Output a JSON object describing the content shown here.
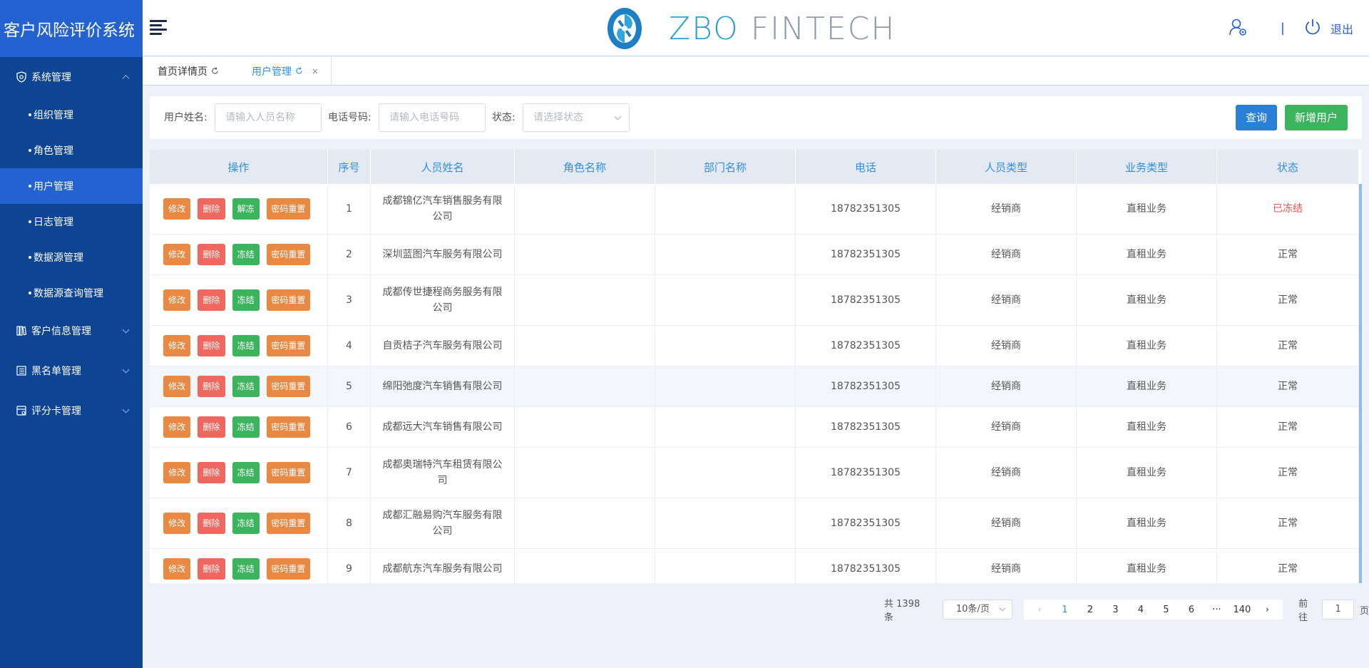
{
  "app": {
    "title": "客户风险评价系统"
  },
  "header": {
    "logo_text_primary": "ZBO",
    "logo_text_secondary": "FINTECH",
    "logout_label": "退出",
    "separator": "|"
  },
  "sidebar": {
    "groups": [
      {
        "label": "系统管理",
        "icon": "shield-gear-icon",
        "expanded": true,
        "items": [
          {
            "label": "组织管理",
            "active": false
          },
          {
            "label": "角色管理",
            "active": false
          },
          {
            "label": "用户管理",
            "active": true
          },
          {
            "label": "日志管理",
            "active": false
          },
          {
            "label": "数据源管理",
            "active": false
          },
          {
            "label": "数据源查询管理",
            "active": false
          }
        ]
      },
      {
        "label": "客户信息管理",
        "icon": "books-icon",
        "expanded": false
      },
      {
        "label": "黑名单管理",
        "icon": "list-book-icon",
        "expanded": false
      },
      {
        "label": "评分卡管理",
        "icon": "card-icon",
        "expanded": false
      }
    ]
  },
  "tabs": [
    {
      "label": "首页详情页",
      "active": false
    },
    {
      "label": "用户管理",
      "active": true,
      "close": "×"
    }
  ],
  "filter": {
    "name_label": "用户姓名:",
    "name_placeholder": "请输入人员名称",
    "phone_label": "电话号码:",
    "phone_placeholder": "请输入电话号码",
    "status_label": "状态:",
    "status_placeholder": "请选择状态",
    "query_button": "查询",
    "add_button": "新增用户"
  },
  "table": {
    "columns": [
      "操作",
      "序号",
      "人员姓名",
      "角色名称",
      "部门名称",
      "电话",
      "人员类型",
      "业务类型",
      "状态"
    ],
    "actions": {
      "edit": "修改",
      "delete": "删除",
      "reset": "密码重置"
    },
    "rows": [
      {
        "no": "1",
        "name": "成都锦亿汽车销售服务有限公司",
        "role": "",
        "dept": "",
        "phone": "18782351305",
        "ptype": "经销商",
        "btype": "直租业务",
        "status": "已冻结",
        "toggle": "解冻",
        "frozen": true
      },
      {
        "no": "2",
        "name": "深圳蓝图汽车服务有限公司",
        "role": "",
        "dept": "",
        "phone": "18782351305",
        "ptype": "经销商",
        "btype": "直租业务",
        "status": "正常",
        "toggle": "冻结",
        "frozen": false
      },
      {
        "no": "3",
        "name": "成都传世捷程商务服务有限公司",
        "role": "",
        "dept": "",
        "phone": "18782351305",
        "ptype": "经销商",
        "btype": "直租业务",
        "status": "正常",
        "toggle": "冻结",
        "frozen": false
      },
      {
        "no": "4",
        "name": "自贡桔子汽车服务有限公司",
        "role": "",
        "dept": "",
        "phone": "18782351305",
        "ptype": "经销商",
        "btype": "直租业务",
        "status": "正常",
        "toggle": "冻结",
        "frozen": false
      },
      {
        "no": "5",
        "name": "绵阳弛度汽车销售有限公司",
        "role": "",
        "dept": "",
        "phone": "18782351305",
        "ptype": "经销商",
        "btype": "直租业务",
        "status": "正常",
        "toggle": "冻结",
        "frozen": false
      },
      {
        "no": "6",
        "name": "成都远大汽车销售有限公司",
        "role": "",
        "dept": "",
        "phone": "18782351305",
        "ptype": "经销商",
        "btype": "直租业务",
        "status": "正常",
        "toggle": "冻结",
        "frozen": false
      },
      {
        "no": "7",
        "name": "成都奥瑞特汽车租赁有限公司",
        "role": "",
        "dept": "",
        "phone": "18782351305",
        "ptype": "经销商",
        "btype": "直租业务",
        "status": "正常",
        "toggle": "冻结",
        "frozen": false
      },
      {
        "no": "8",
        "name": "成都汇融易购汽车服务有限公司",
        "role": "",
        "dept": "",
        "phone": "18782351305",
        "ptype": "经销商",
        "btype": "直租业务",
        "status": "正常",
        "toggle": "冻结",
        "frozen": false
      },
      {
        "no": "9",
        "name": "成都航东汽车服务有限公司",
        "role": "",
        "dept": "",
        "phone": "18782351305",
        "ptype": "经销商",
        "btype": "直租业务",
        "status": "正常",
        "toggle": "冻结",
        "frozen": false
      }
    ]
  },
  "pagination": {
    "total": "共 1398 条",
    "page_size": "10条/页",
    "pages": [
      "1",
      "2",
      "3",
      "4",
      "5",
      "6",
      "···",
      "140"
    ],
    "current": "1",
    "goto_label": "前往",
    "goto_value": "1",
    "goto_suffix": "页"
  },
  "colors": {
    "sidebar_bg": "#0d4494",
    "accent": "#2462d1",
    "link_blue": "#2f8fe8",
    "edit_orange": "#e98943",
    "delete_red": "#f0675f",
    "freeze_green": "#3cb45e",
    "frozen_red": "#f05151"
  }
}
